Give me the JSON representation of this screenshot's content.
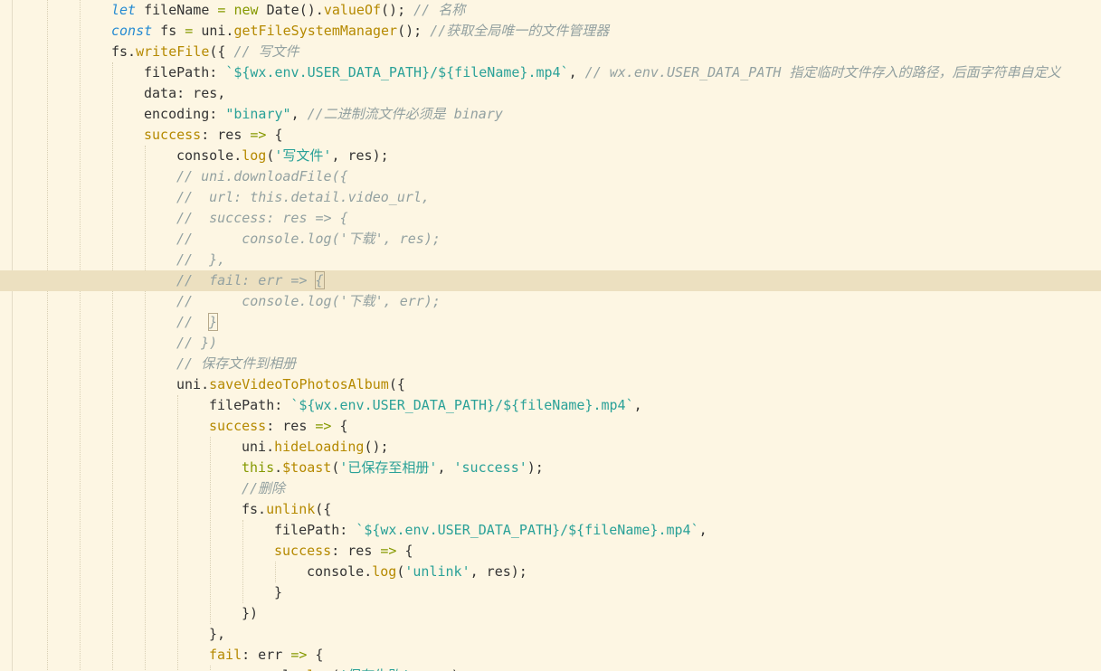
{
  "editor": {
    "lines": [
      {
        "indent": 3,
        "tokens": [
          [
            "kw",
            "let"
          ],
          [
            "pl",
            " fileName "
          ],
          [
            "op",
            "="
          ],
          [
            "pl",
            " "
          ],
          [
            "kw2",
            "new"
          ],
          [
            "pl",
            " Date()."
          ],
          [
            "fn",
            "valueOf"
          ],
          [
            "pl",
            "(); "
          ],
          [
            "cm",
            "// 名称"
          ]
        ]
      },
      {
        "indent": 3,
        "tokens": [
          [
            "kw",
            "const"
          ],
          [
            "pl",
            " fs "
          ],
          [
            "op",
            "="
          ],
          [
            "pl",
            " uni."
          ],
          [
            "fn",
            "getFileSystemManager"
          ],
          [
            "pl",
            "(); "
          ],
          [
            "cm",
            "//获取全局唯一的文件管理器"
          ]
        ]
      },
      {
        "indent": 3,
        "tokens": [
          [
            "pl",
            "fs."
          ],
          [
            "fn",
            "writeFile"
          ],
          [
            "pl",
            "({ "
          ],
          [
            "cm",
            "// 写文件"
          ]
        ]
      },
      {
        "indent": 4,
        "tokens": [
          [
            "pl",
            "filePath: "
          ],
          [
            "str",
            "`${wx.env.USER_DATA_PATH}/${fileName}.mp4`"
          ],
          [
            "pl",
            ", "
          ],
          [
            "cm",
            "// wx.env.USER_DATA_PATH 指定临时文件存入的路径，后面字符串自定义"
          ]
        ]
      },
      {
        "indent": 4,
        "tokens": [
          [
            "pl",
            "data: res,"
          ]
        ]
      },
      {
        "indent": 4,
        "tokens": [
          [
            "pl",
            "encoding: "
          ],
          [
            "str",
            "\"binary\""
          ],
          [
            "pl",
            ", "
          ],
          [
            "cm",
            "//二进制流文件必须是 binary"
          ]
        ]
      },
      {
        "indent": 4,
        "tokens": [
          [
            "fn",
            "success"
          ],
          [
            "pl",
            ": res "
          ],
          [
            "op",
            "=>"
          ],
          [
            "pl",
            " {"
          ]
        ]
      },
      {
        "indent": 5,
        "tokens": [
          [
            "pl",
            "console."
          ],
          [
            "fn",
            "log"
          ],
          [
            "pl",
            "("
          ],
          [
            "str",
            "'写文件'"
          ],
          [
            "pl",
            ", res);"
          ]
        ]
      },
      {
        "indent": 5,
        "tokens": [
          [
            "cm",
            "// uni.downloadFile({"
          ]
        ]
      },
      {
        "indent": 5,
        "tokens": [
          [
            "cm",
            "//  url: this.detail.video_url,"
          ]
        ]
      },
      {
        "indent": 5,
        "tokens": [
          [
            "cm",
            "//  success: res => {"
          ]
        ]
      },
      {
        "indent": 5,
        "tokens": [
          [
            "cm",
            "//      console.log('下载', res);"
          ]
        ]
      },
      {
        "indent": 5,
        "tokens": [
          [
            "cm",
            "//  },"
          ]
        ]
      },
      {
        "indent": 5,
        "hl": true,
        "tokens": [
          [
            "cm",
            "//  fail: err => "
          ],
          [
            "cmb",
            "{"
          ]
        ]
      },
      {
        "indent": 5,
        "tokens": [
          [
            "cm",
            "//      console.log('下载', err);"
          ]
        ]
      },
      {
        "indent": 5,
        "tokens": [
          [
            "cm",
            "//  "
          ],
          [
            "cmb",
            "}"
          ]
        ]
      },
      {
        "indent": 5,
        "tokens": [
          [
            "cm",
            "// })"
          ]
        ]
      },
      {
        "indent": 5,
        "tokens": [
          [
            "cm",
            "// 保存文件到相册"
          ]
        ]
      },
      {
        "indent": 5,
        "tokens": [
          [
            "pl",
            "uni."
          ],
          [
            "fn",
            "saveVideoToPhotosAlbum"
          ],
          [
            "pl",
            "({"
          ]
        ]
      },
      {
        "indent": 6,
        "tokens": [
          [
            "pl",
            "filePath: "
          ],
          [
            "str",
            "`${wx.env.USER_DATA_PATH}/${fileName}.mp4`"
          ],
          [
            "pl",
            ","
          ]
        ]
      },
      {
        "indent": 6,
        "tokens": [
          [
            "fn",
            "success"
          ],
          [
            "pl",
            ": res "
          ],
          [
            "op",
            "=>"
          ],
          [
            "pl",
            " {"
          ]
        ]
      },
      {
        "indent": 7,
        "tokens": [
          [
            "pl",
            "uni."
          ],
          [
            "fn",
            "hideLoading"
          ],
          [
            "pl",
            "();"
          ]
        ]
      },
      {
        "indent": 7,
        "tokens": [
          [
            "kw2",
            "this"
          ],
          [
            "pl",
            "."
          ],
          [
            "fn",
            "$toast"
          ],
          [
            "pl",
            "("
          ],
          [
            "str",
            "'已保存至相册'"
          ],
          [
            "pl",
            ", "
          ],
          [
            "str",
            "'success'"
          ],
          [
            "pl",
            ");"
          ]
        ]
      },
      {
        "indent": 7,
        "tokens": [
          [
            "cm",
            "//删除"
          ]
        ]
      },
      {
        "indent": 7,
        "tokens": [
          [
            "pl",
            "fs."
          ],
          [
            "fn",
            "unlink"
          ],
          [
            "pl",
            "({"
          ]
        ]
      },
      {
        "indent": 8,
        "tokens": [
          [
            "pl",
            "filePath: "
          ],
          [
            "str",
            "`${wx.env.USER_DATA_PATH}/${fileName}.mp4`"
          ],
          [
            "pl",
            ","
          ]
        ]
      },
      {
        "indent": 8,
        "tokens": [
          [
            "fn",
            "success"
          ],
          [
            "pl",
            ": res "
          ],
          [
            "op",
            "=>"
          ],
          [
            "pl",
            " {"
          ]
        ]
      },
      {
        "indent": 9,
        "tokens": [
          [
            "pl",
            "console."
          ],
          [
            "fn",
            "log"
          ],
          [
            "pl",
            "("
          ],
          [
            "str",
            "'unlink'"
          ],
          [
            "pl",
            ", res);"
          ]
        ]
      },
      {
        "indent": 8,
        "tokens": [
          [
            "pl",
            "}"
          ]
        ]
      },
      {
        "indent": 7,
        "tokens": [
          [
            "pl",
            "})"
          ]
        ]
      },
      {
        "indent": 6,
        "tokens": [
          [
            "pl",
            "},"
          ]
        ]
      },
      {
        "indent": 6,
        "tokens": [
          [
            "fn",
            "fail"
          ],
          [
            "pl",
            ": err "
          ],
          [
            "op",
            "=>"
          ],
          [
            "pl",
            " {"
          ]
        ]
      },
      {
        "indent": 7,
        "tokens": [
          [
            "pl",
            "console."
          ],
          [
            "fn",
            "log"
          ],
          [
            "pl",
            "("
          ],
          [
            "str",
            "'保存失败'"
          ],
          [
            "pl",
            ", err);"
          ]
        ]
      }
    ]
  }
}
